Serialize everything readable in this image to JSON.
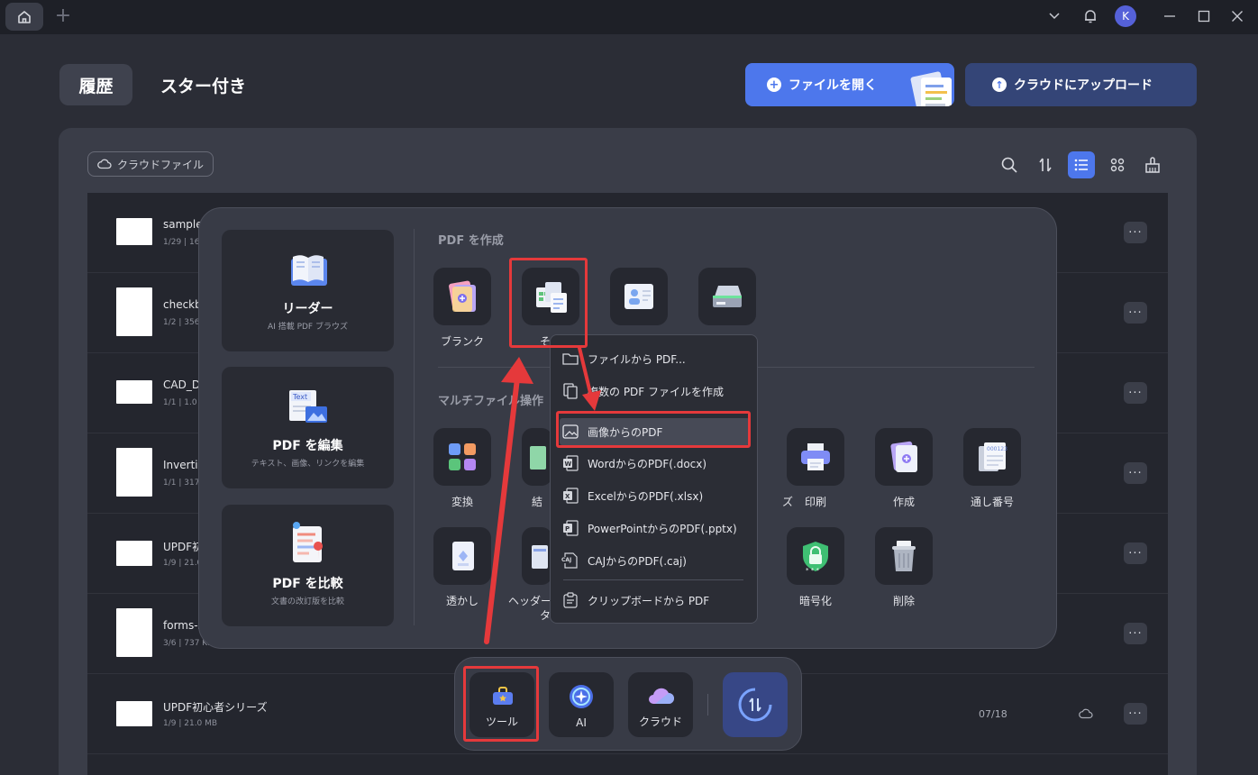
{
  "titlebar": {
    "avatar_initial": "K",
    "icons": [
      "home-icon",
      "plus-icon",
      "chevron-down-icon",
      "bell-icon",
      "minimize-icon",
      "maximize-icon",
      "close-icon"
    ]
  },
  "header": {
    "tabs": [
      {
        "label": "履歴"
      },
      {
        "label": "スター付き"
      }
    ],
    "open_file_label": "ファイルを開く",
    "upload_cloud_label": "クラウドにアップロード"
  },
  "filter": {
    "cloud_files_label": "クラウドファイル"
  },
  "files": [
    {
      "name": "sample-",
      "meta": "1/29 | 16."
    },
    {
      "name": "checkb",
      "meta": "1/2 | 356"
    },
    {
      "name": "CAD_D",
      "meta": "1/1 | 1.0"
    },
    {
      "name": "Invertib",
      "meta": "1/1 | 317"
    },
    {
      "name": "UPDF初",
      "meta": "1/9 | 21.0"
    },
    {
      "name": "forms-s",
      "meta": "3/6 | 737 KB"
    },
    {
      "name": "UPDF初心者シリーズ",
      "meta": "1/9 | 21.0 MB",
      "date": "07/18"
    }
  ],
  "tools_panel": {
    "cards": [
      {
        "title": "リーダー",
        "subtitle": "AI 搭載 PDF ブラウズ"
      },
      {
        "title": "PDF を編集",
        "subtitle": "テキスト、画像、リンクを編集"
      },
      {
        "title": "PDF を比較",
        "subtitle": "文書の改訂版を比較"
      }
    ],
    "create_section": "PDF を作成",
    "create_tools": [
      {
        "label": "ブランク"
      },
      {
        "label": "その"
      },
      {
        "label": ""
      },
      {
        "label": ""
      }
    ],
    "multi_section": "マルチファイル操作",
    "multi_tools_row1": [
      {
        "label": "変換"
      },
      {
        "label": "結"
      },
      {
        "label": "ズ"
      },
      {
        "label": "印刷"
      },
      {
        "label": "作成"
      },
      {
        "label": "通し番号"
      }
    ],
    "multi_tools_row2": [
      {
        "label": "透かし"
      },
      {
        "label": "ヘッダー"
      },
      {
        "label": "タ"
      },
      {
        "label": "暗号化"
      },
      {
        "label": "削除"
      }
    ]
  },
  "create_menu": {
    "items": [
      {
        "label": "ファイルから PDF...",
        "icon": "folder-icon"
      },
      {
        "label": "複数の PDF ファイルを作成",
        "icon": "files-icon"
      },
      {
        "label": "画像からのPDF",
        "icon": "image-icon"
      },
      {
        "label": "WordからのPDF(.docx)",
        "icon": "word-icon"
      },
      {
        "label": "ExcelからのPDF(.xlsx)",
        "icon": "excel-icon"
      },
      {
        "label": "PowerPointからのPDF(.pptx)",
        "icon": "powerpoint-icon"
      },
      {
        "label": "CAJからのPDF(.caj)",
        "icon": "caj-icon"
      },
      {
        "label": "クリップボードから PDF",
        "icon": "clipboard-icon"
      }
    ],
    "caj_badge": "CAJ"
  },
  "bottom_bar": {
    "tools_label": "ツール",
    "ai_label": "AI",
    "cloud_label": "クラウド"
  },
  "colors": {
    "accent": "#4d77ec",
    "highlight": "#e5393b",
    "background": "#2b2d36"
  }
}
